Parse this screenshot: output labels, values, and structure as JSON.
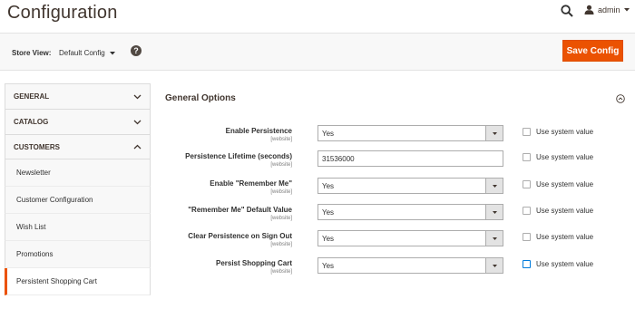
{
  "header": {
    "title": "Configuration",
    "user_name": "admin"
  },
  "toolbar": {
    "scope_label": "Store View:",
    "scope_value": "Default Config",
    "help": "?",
    "save_label": "Save Config"
  },
  "sidebar": {
    "tabs": [
      {
        "label": "GENERAL"
      },
      {
        "label": "CATALOG"
      },
      {
        "label": "CUSTOMERS"
      }
    ],
    "items": [
      {
        "label": "Newsletter"
      },
      {
        "label": "Customer Configuration"
      },
      {
        "label": "Wish List"
      },
      {
        "label": "Promotions"
      },
      {
        "label": "Persistent Shopping Cart"
      }
    ]
  },
  "section": {
    "title": "General Options",
    "use_system_label": "Use system value",
    "rows": [
      {
        "label": "Enable Persistence",
        "scope": "[website]",
        "value": "Yes"
      },
      {
        "label": "Persistence Lifetime (seconds)",
        "scope": "[website]",
        "value": "31536000"
      },
      {
        "label": "Enable \"Remember Me\"",
        "scope": "[website]",
        "value": "Yes"
      },
      {
        "label": "\"Remember Me\" Default Value",
        "scope": "[website]",
        "value": "Yes"
      },
      {
        "label": "Clear Persistence on Sign Out",
        "scope": "[website]",
        "value": "Yes"
      },
      {
        "label": "Persist Shopping Cart",
        "scope": "[website]",
        "value": "Yes"
      }
    ]
  },
  "colors": {
    "accent": "#eb5202",
    "text": "#303030",
    "panel": "#f8f8f8"
  }
}
